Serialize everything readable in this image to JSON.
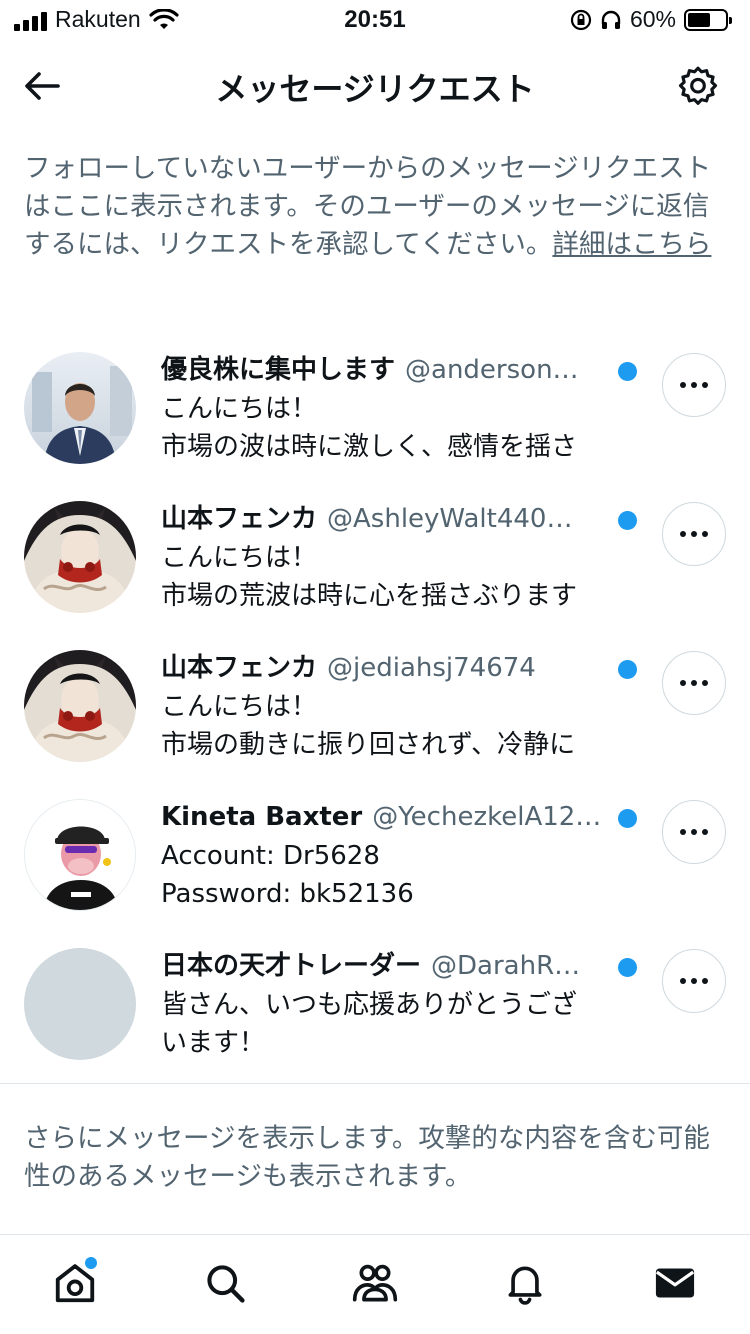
{
  "status_bar": {
    "carrier": "Rakuten",
    "time": "20:51",
    "battery": "60%",
    "battery_level": 0.6
  },
  "header": {
    "title": "メッセージリクエスト",
    "back_icon": "arrow-left-icon",
    "settings_icon": "gear-icon"
  },
  "info": {
    "text": "フォローしていないユーザーからのメッセージリクエストはここに表示されます。そのユーザーのメッセージに返信するには、リクエストを承認してください。",
    "link": "詳細はこちら"
  },
  "requests": [
    {
      "name": "優良株に集中します",
      "handle": "@anderson…",
      "line1": "こんにちは！",
      "line2": "市場の波は時に激しく、感情を揺さ",
      "unread": true
    },
    {
      "name": "山本フェンカ",
      "handle": "@AshleyWalt440…",
      "line1": "こんにちは！",
      "line2": "市場の荒波は時に心を揺さぶります",
      "unread": true
    },
    {
      "name": "山本フェンカ",
      "handle": "@jediahsj74674",
      "line1": "こんにちは！",
      "line2": "市場の動きに振り回されず、冷静に",
      "unread": true
    },
    {
      "name": "Kineta Baxter",
      "handle": "@YechezkelA12…",
      "line1": "Account: Dr5628",
      "line2": "Password: bk52136",
      "unread": true
    },
    {
      "name": "日本の天才トレーダー",
      "handle": "@DarahR…",
      "line1": "皆さん、いつも応援ありがとうござ",
      "line2": "います！",
      "unread": true
    }
  ],
  "more_info": "さらにメッセージを表示します。攻撃的な内容を含む可能性のあるメッセージも表示されます。",
  "tabbar": {
    "tabs": [
      "home-icon",
      "search-icon",
      "communities-icon",
      "bell-icon",
      "mail-icon"
    ],
    "accent": "#1d9bf0"
  }
}
